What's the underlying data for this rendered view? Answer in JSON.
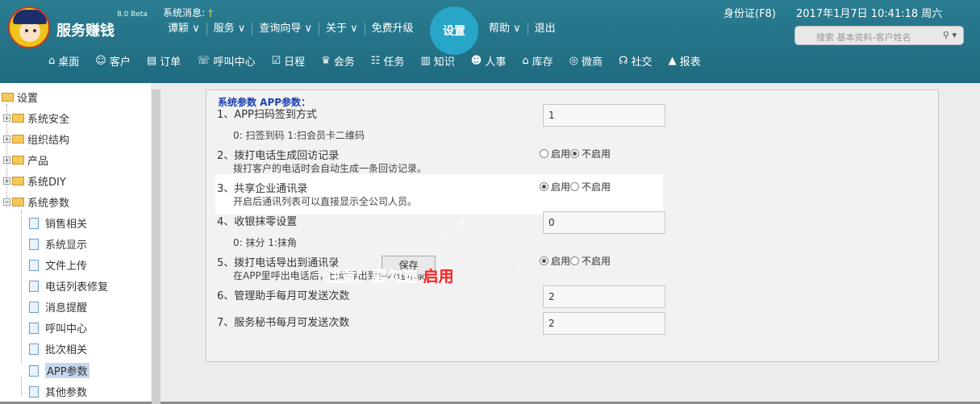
{
  "header": {
    "brand": "服务赚钱",
    "version": "8.0 Beta",
    "sysmsg_label": "系统消息:",
    "sysmsg_key": "†",
    "menu": [
      "谭颖 ∨",
      "服务 ∨",
      "查询向导 ∨",
      "关于 ∨",
      "免费升级"
    ],
    "settings": "设置",
    "right_menu": [
      "帮助 ∨",
      "退出"
    ],
    "idcard": "身份证(F8)",
    "datetime": "2017年1月7日 10:41:18 周六",
    "search_placeholder": "搜索 基本资料-客户姓名",
    "nav": [
      {
        "icon": "⌂",
        "label": "桌面"
      },
      {
        "icon": "☺",
        "label": "客户"
      },
      {
        "icon": "▤",
        "label": "订单"
      },
      {
        "icon": "☏",
        "label": "呼叫中心"
      },
      {
        "icon": "☑",
        "label": "日程"
      },
      {
        "icon": "♛",
        "label": "会务"
      },
      {
        "icon": "☷",
        "label": "任务"
      },
      {
        "icon": "▥",
        "label": "知识"
      },
      {
        "icon": "☻",
        "label": "人事"
      },
      {
        "icon": "⌂",
        "label": "库存"
      },
      {
        "icon": "◎",
        "label": "微商"
      },
      {
        "icon": "☊",
        "label": "社交"
      },
      {
        "icon": "▲",
        "label": "报表"
      }
    ]
  },
  "sidebar": {
    "root": "设置",
    "groups": [
      "系统安全",
      "组织结构",
      "产品",
      "系统DIY",
      "系统参数"
    ],
    "children": [
      "销售相关",
      "系统显示",
      "文件上传",
      "电话列表修复",
      "消息提醒",
      "呼叫中心",
      "批次相关",
      "APP参数",
      "其他参数"
    ]
  },
  "panel": {
    "title": "系统参数 APP参数：",
    "rows": [
      {
        "label": "1、APP扫码签到方式",
        "sub": "0: 扫签到码 1:扫会员卡二维码",
        "value": "1"
      },
      {
        "label": "2、拨打电话生成回访记录",
        "sub": "拨打客户的电话时会自动生成一条回访记录。",
        "opt1": "启用",
        "opt2": "不启用"
      },
      {
        "label": "3、共享企业通讯录",
        "sub": "开启后通讯列表可以直接显示全公司人员。",
        "opt1": "启用",
        "opt2": "不启用"
      },
      {
        "label": "4、收银抹零设置",
        "sub": "0: 抹分 1:抹角",
        "value": "0"
      },
      {
        "label": "5、拨打电话导出到通讯录",
        "sub": "在APP里呼出电话后，自动导出到手机通讯录",
        "opt1": "启用",
        "opt2": "不启用"
      },
      {
        "label": "6、管理助手每月可发送次数",
        "value": "2"
      },
      {
        "label": "7、服务秘书每月可发送次数",
        "value": "2"
      }
    ],
    "save": "保存"
  },
  "annotation": {
    "text": "注意：要勾选 ",
    "highlight": "启用"
  }
}
